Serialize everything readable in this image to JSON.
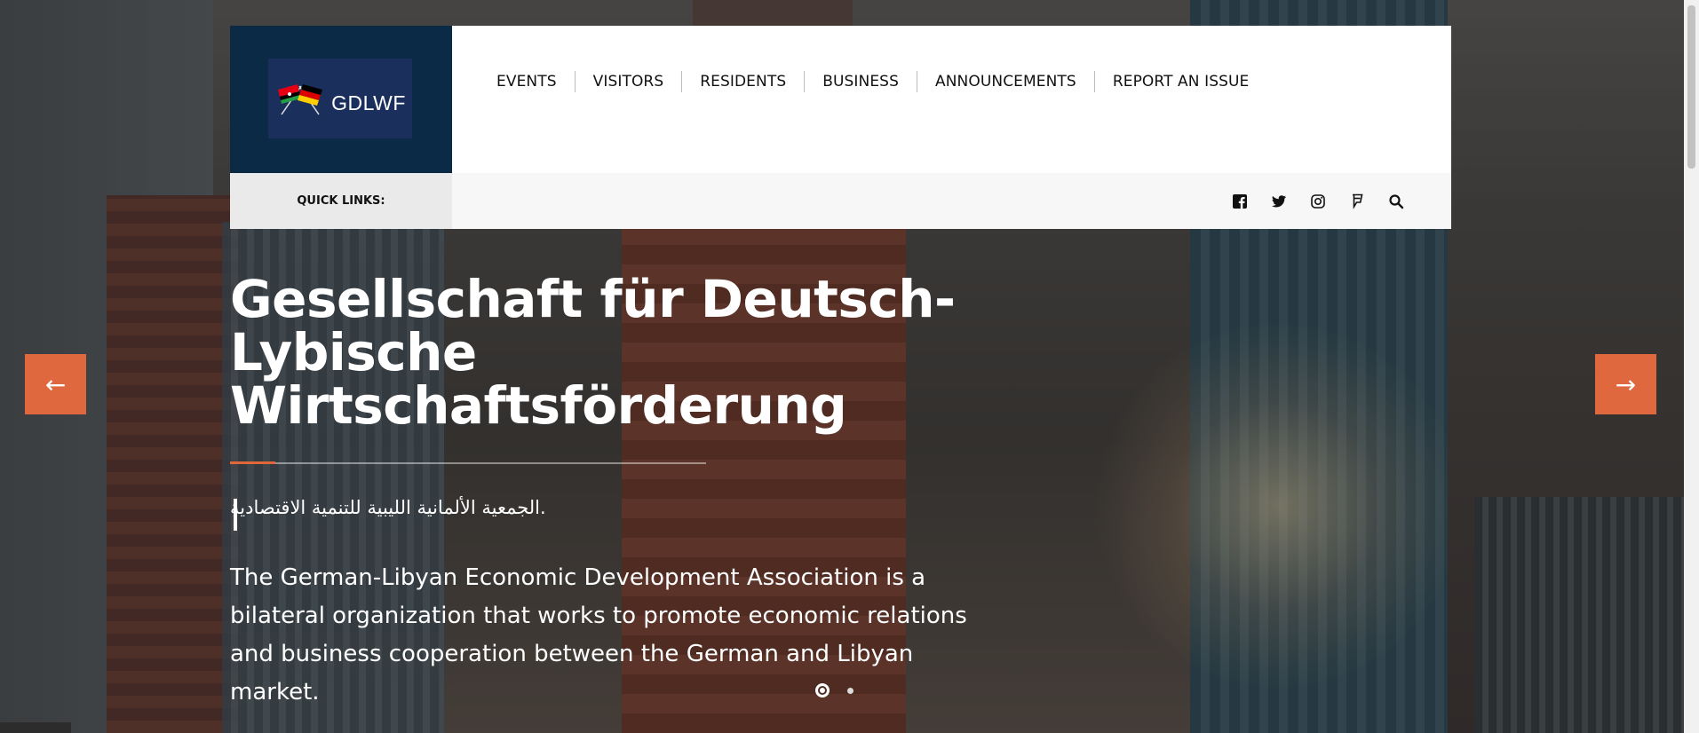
{
  "logo": {
    "text": "GDLWF"
  },
  "nav": {
    "items": [
      {
        "label": "EVENTS"
      },
      {
        "label": "VISITORS"
      },
      {
        "label": "RESIDENTS"
      },
      {
        "label": "BUSINESS"
      },
      {
        "label": "ANNOUNCEMENTS"
      },
      {
        "label": "REPORT AN ISSUE"
      }
    ]
  },
  "quick_links": {
    "label": "QUICK LINKS:",
    "icons": [
      "facebook-icon",
      "twitter-icon",
      "instagram-icon",
      "foursquare-icon",
      "search-icon"
    ]
  },
  "hero": {
    "title": "Gesellschaft für Deutsch-Lybische Wirtschaftsförderung",
    "arabic": ".الجمعية الألمانية الليبية للتنمية الاقتصادية",
    "description": "The German-Libyan Economic Development Association is a bilateral organization that works to promote economic relations and business cooperation between the German and Libyan market."
  },
  "slider": {
    "prev_label": "←",
    "next_label": "→",
    "slide_count": 2,
    "active_slide": 1
  },
  "colors": {
    "accent": "#e0683e",
    "logo_bg": "#0b2a45",
    "logo_inner": "#1b2f5c"
  }
}
